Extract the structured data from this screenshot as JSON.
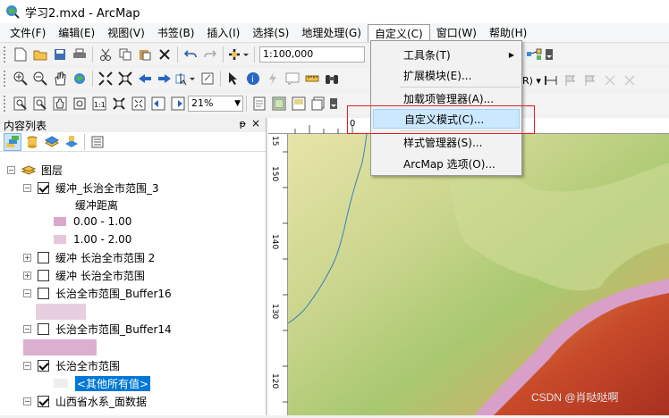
{
  "window": {
    "title": "学习2.mxd - ArcMap"
  },
  "menubar": {
    "items": [
      {
        "label": "文件(F)"
      },
      {
        "label": "编辑(E)"
      },
      {
        "label": "视图(V)"
      },
      {
        "label": "书签(B)"
      },
      {
        "label": "插入(I)"
      },
      {
        "label": "选择(S)"
      },
      {
        "label": "地理处理(G)"
      },
      {
        "label": "自定义(C)"
      },
      {
        "label": "窗口(W)"
      },
      {
        "label": "帮助(H)"
      }
    ]
  },
  "standard_toolbar": {
    "scale_value": "1:100,000"
  },
  "layout_toolbar": {
    "zoom_value": "21%"
  },
  "dropdown": {
    "items": [
      {
        "label": "工具条(T)"
      },
      {
        "label": "扩展模块(E)..."
      },
      {
        "label": "加载项管理器(A)..."
      },
      {
        "label": "自定义模式(C)..."
      },
      {
        "label": "样式管理器(S)..."
      },
      {
        "label": "ArcMap 选项(O)..."
      }
    ]
  },
  "toc": {
    "title": "内容列表",
    "pin_glyph": "ᵽ",
    "close_glyph": "×",
    "root_label": "图层",
    "layers": [
      {
        "label": "缓冲_长治全市范围_3",
        "checked": true,
        "expanded": true
      },
      {
        "label": "缓冲距离"
      },
      {
        "label": "0.00 - 1.00"
      },
      {
        "label": "1.00 - 2.00"
      },
      {
        "label": "缓冲 长治全市范围 2",
        "checked": false,
        "expanded": false
      },
      {
        "label": "缓冲 长治全市范围",
        "checked": false,
        "expanded": false
      },
      {
        "label": "长治全市范围_Buffer16",
        "checked": false,
        "expanded": true
      },
      {
        "label": "长治全市范围_Buffer14",
        "checked": false,
        "expanded": true
      },
      {
        "label": "长治全市范围",
        "checked": true,
        "expanded": true
      },
      {
        "label": "<其他所有值>"
      },
      {
        "label": "山西省水系_面数据",
        "checked": true,
        "expanded": true
      }
    ]
  },
  "rulers": {
    "top_labels": [
      "0"
    ],
    "left_labels": [
      "15",
      "150",
      "140",
      "130",
      "120"
    ]
  },
  "colors": {
    "swatch_1": "#d9a9c9",
    "swatch_2": "#e5c7dc",
    "selection": "#0078d7",
    "red_box": "#e02020"
  },
  "watermark": "CSDN @肖哒哒啊"
}
